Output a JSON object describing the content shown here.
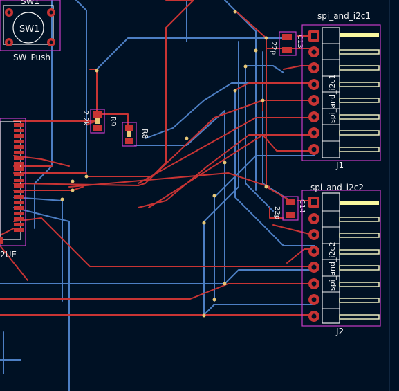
{
  "components": {
    "sw1": {
      "reference": "SW1",
      "value": "SW_Push",
      "body_label": "SW1"
    },
    "j1": {
      "reference": "J1",
      "value": "spi_and_i2c1",
      "body_label": "spi_and_i2c1"
    },
    "j2": {
      "reference": "J2",
      "value": "spi_and_i2c2",
      "body_label": "spi_and_i2c2"
    },
    "r9": {
      "reference": "R9"
    },
    "r8": {
      "reference": "R8"
    },
    "c13": {
      "reference": "C13"
    },
    "c14": {
      "reference": "C14"
    },
    "u_partial": {
      "reference": "2UE"
    },
    "small_labels": {
      "r9_side": "2.2k",
      "c13_side": "22p",
      "c14_side": "22p"
    }
  },
  "colors": {
    "background": "#001124",
    "front_copper": "#c83434",
    "back_copper": "#4d7fc4",
    "silkscreen": "#f0f0f0",
    "courtyard": "#c83cc8",
    "via": "#e8c878"
  }
}
